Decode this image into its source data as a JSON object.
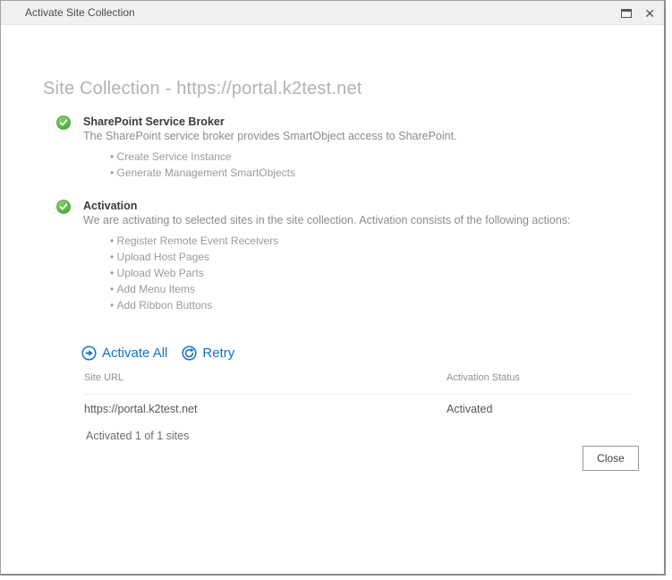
{
  "window": {
    "title": "Activate Site Collection",
    "close_glyph": "✕"
  },
  "page": {
    "heading": "Site Collection - https://portal.k2test.net"
  },
  "sections": [
    {
      "title": "SharePoint Service Broker",
      "description": "The SharePoint service broker provides SmartObject access to SharePoint.",
      "bullets": [
        "Create Service Instance",
        "Generate Management SmartObjects"
      ]
    },
    {
      "title": "Activation",
      "description": "We are activating to selected sites in the site collection. Activation consists of the following actions:",
      "bullets": [
        "Register Remote Event Receivers",
        "Upload Host Pages",
        "Upload Web Parts",
        "Add Menu Items",
        "Add Ribbon Buttons"
      ]
    }
  ],
  "actions": {
    "activate_all_label": "Activate All",
    "retry_label": "Retry"
  },
  "table": {
    "columns": [
      "Site URL",
      "Activation Status"
    ],
    "rows": [
      {
        "site_url": "https://portal.k2test.net",
        "status": "Activated"
      }
    ]
  },
  "summary_text": "Activated 1 of 1 sites",
  "footer": {
    "close_label": "Close"
  },
  "colors": {
    "link_blue": "#1173c6",
    "check_green": "#56b245",
    "titlebar_bg": "#f0f0f0"
  }
}
